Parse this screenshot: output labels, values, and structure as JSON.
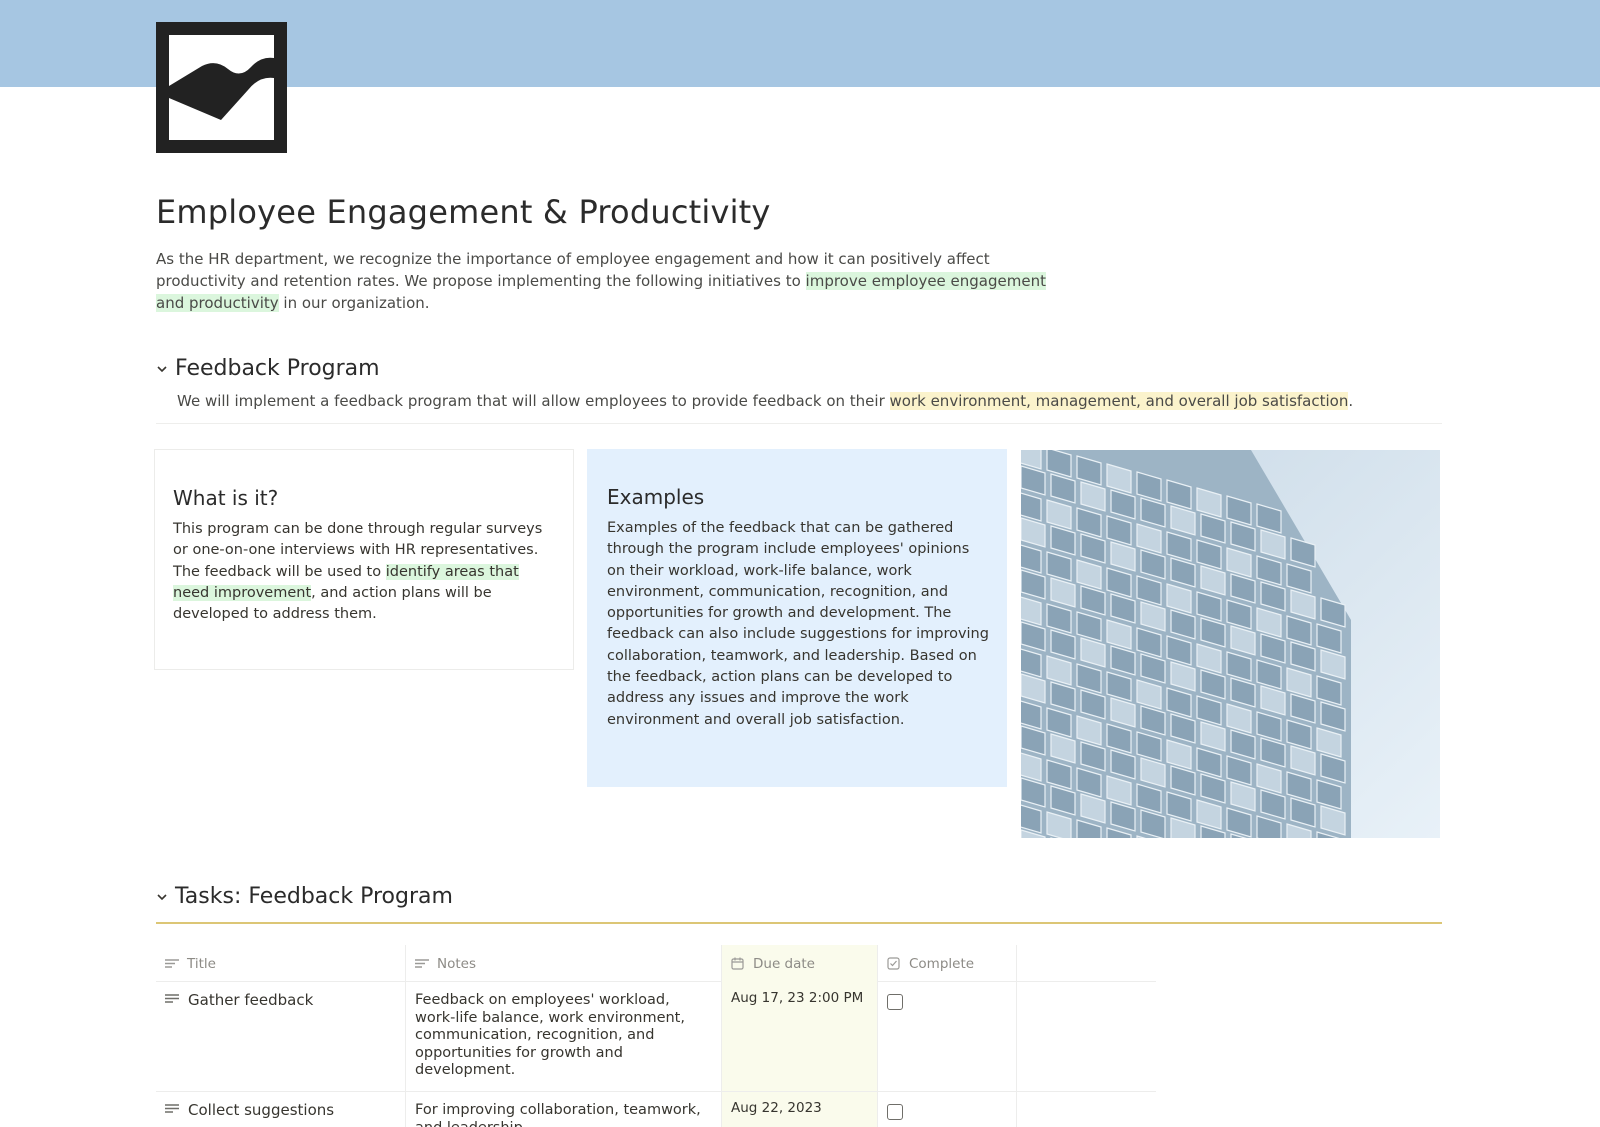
{
  "page": {
    "title": "Employee Engagement & Productivity",
    "intro": {
      "before": "As the HR department, we recognize the importance of employee engagement and how it can positively affect productivity and retention rates. We propose implementing the following initiatives to ",
      "highlight": "improve employee engagement and productivity",
      "after": " in our organization."
    }
  },
  "feedback_section": {
    "heading": "Feedback Program",
    "lead": {
      "before": "We will implement a feedback program that will allow employees to provide feedback on their ",
      "highlight": "work environment, management, and overall job satisfaction",
      "after": "."
    }
  },
  "cards": {
    "what": {
      "heading": "What is it?",
      "before": "This program can be done through regular surveys or one-on-one interviews with HR representatives. The feedback will be used to ",
      "highlight": "identify areas that need improvement",
      "after": ", and action plans will be developed to address them."
    },
    "examples": {
      "heading": "Examples",
      "body": "Examples of the feedback that can be gathered through the program include employees' opinions on their workload, work-life balance, work environment, communication, recognition, and opportunities for growth and development. The feedback can also include suggestions for improving collaboration, teamwork, and leadership. Based on the feedback, action plans can be developed to address any issues and improve the work environment and overall job satisfaction."
    }
  },
  "tasks_section": {
    "heading": "Tasks: Feedback Program",
    "columns": {
      "title": "Title",
      "notes": "Notes",
      "due": "Due date",
      "complete": "Complete"
    },
    "rows": [
      {
        "title": "Gather feedback",
        "notes": "Feedback on employees' workload, work-life balance, work environment, communication, recognition, and opportunities for growth and development.",
        "due": "Aug 17, 23 2:00 PM",
        "complete": false
      },
      {
        "title": "Collect suggestions",
        "notes": "For improving collaboration, teamwork, and leadership.",
        "due": "Aug 22, 2023",
        "complete": false
      }
    ]
  },
  "colors": {
    "cover": "#a6c6e2",
    "highlight_green": "#dbf6dd",
    "highlight_yellow": "#fbf3cc",
    "examples_card": "#e3f0fd",
    "tasks_rule": "#dcc675",
    "due_column": "#fafbec"
  }
}
